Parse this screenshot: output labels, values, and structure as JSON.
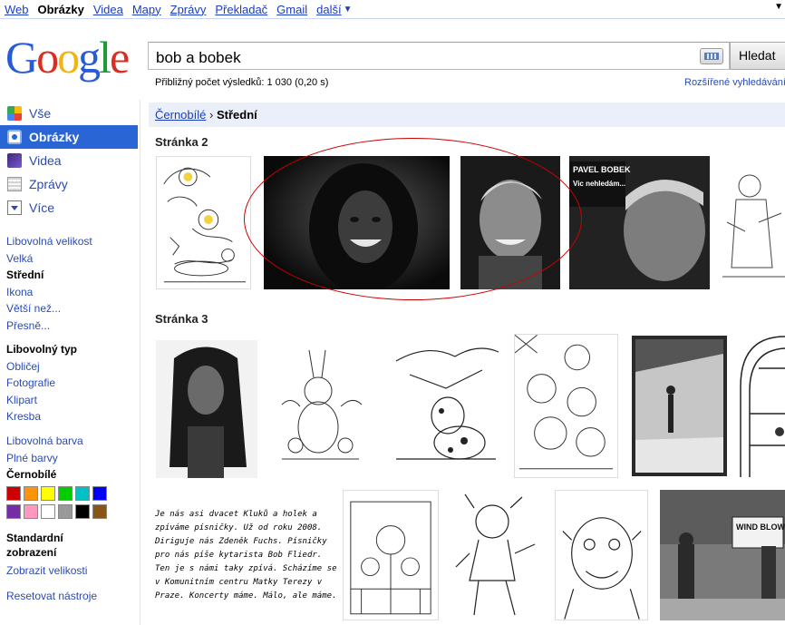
{
  "topbar": {
    "links": [
      "Web",
      "Obrázky",
      "Videa",
      "Mapy",
      "Zprávy",
      "Překladač",
      "Gmail",
      "další"
    ],
    "active": "Obrázky",
    "more_arrow": "▼"
  },
  "logo": {
    "text": "Google"
  },
  "search": {
    "query": "bob a bobek",
    "button_label": "Hledat"
  },
  "stats": "Přibližný počet výsledků: 1 030 (0,20 s)",
  "advanced_link": "Rozšířené vyhledávání",
  "nav": [
    {
      "label": "Vše",
      "icon": "all-icon"
    },
    {
      "label": "Obrázky",
      "icon": "images-icon",
      "selected": true
    },
    {
      "label": "Videa",
      "icon": "videos-icon"
    },
    {
      "label": "Zprávy",
      "icon": "news-icon"
    },
    {
      "label": "Více",
      "icon": "more-icon"
    }
  ],
  "filters": {
    "size": [
      "Libovolná velikost",
      "Velká",
      "Střední",
      "Ikona",
      "Větší než...",
      "Přesně..."
    ],
    "size_selected": "Střední",
    "type": [
      "Libovolný typ",
      "Obličej",
      "Fotografie",
      "Klipart",
      "Kresba"
    ],
    "type_selected": "Libovolný typ",
    "color": [
      "Libovolná barva",
      "Plné barvy",
      "Černobílé"
    ],
    "color_selected": "Černobílé",
    "swatch_colors": [
      "#cc0000",
      "#fb940b",
      "#ffff00",
      "#00cc00",
      "#03c0c6",
      "#0000ff",
      "#762ca7",
      "#ff98bf",
      "#ffffff",
      "#999999",
      "#000000",
      "#885418"
    ],
    "view_title": "Standardní zobrazení",
    "view_alt": "Zobrazit velikosti",
    "reset": "Resetovat nástroje"
  },
  "breadcrumb": {
    "parent": "Černobílé",
    "separator": "›",
    "current": "Střední"
  },
  "pages": [
    "Stránka 2",
    "Stránka 3"
  ],
  "thumb_text": {
    "pavel_title": "PAVEL BOBEK",
    "pavel_subtitle": "Vic nehledám...",
    "sign": "WIND BLOW"
  },
  "handwriting": "Je nás asi dvacet Kluků a holek a zpíváme písničky. Už od roku 2008. Diriguje nás Zdeněk Fuchs. Písničky pro nás píše kytarista Bob Fliedr. Ten je s námi taky zpívá. Scházíme se v Komunitním centru Matky Terezy v Praze. Koncerty máme. Málo, ale máme.",
  "colors": {
    "link": "#1a3dc1",
    "selected_nav": "#2a65d6",
    "crumb_bg": "#ebeff9",
    "highlight_ring": "#cc0000"
  }
}
